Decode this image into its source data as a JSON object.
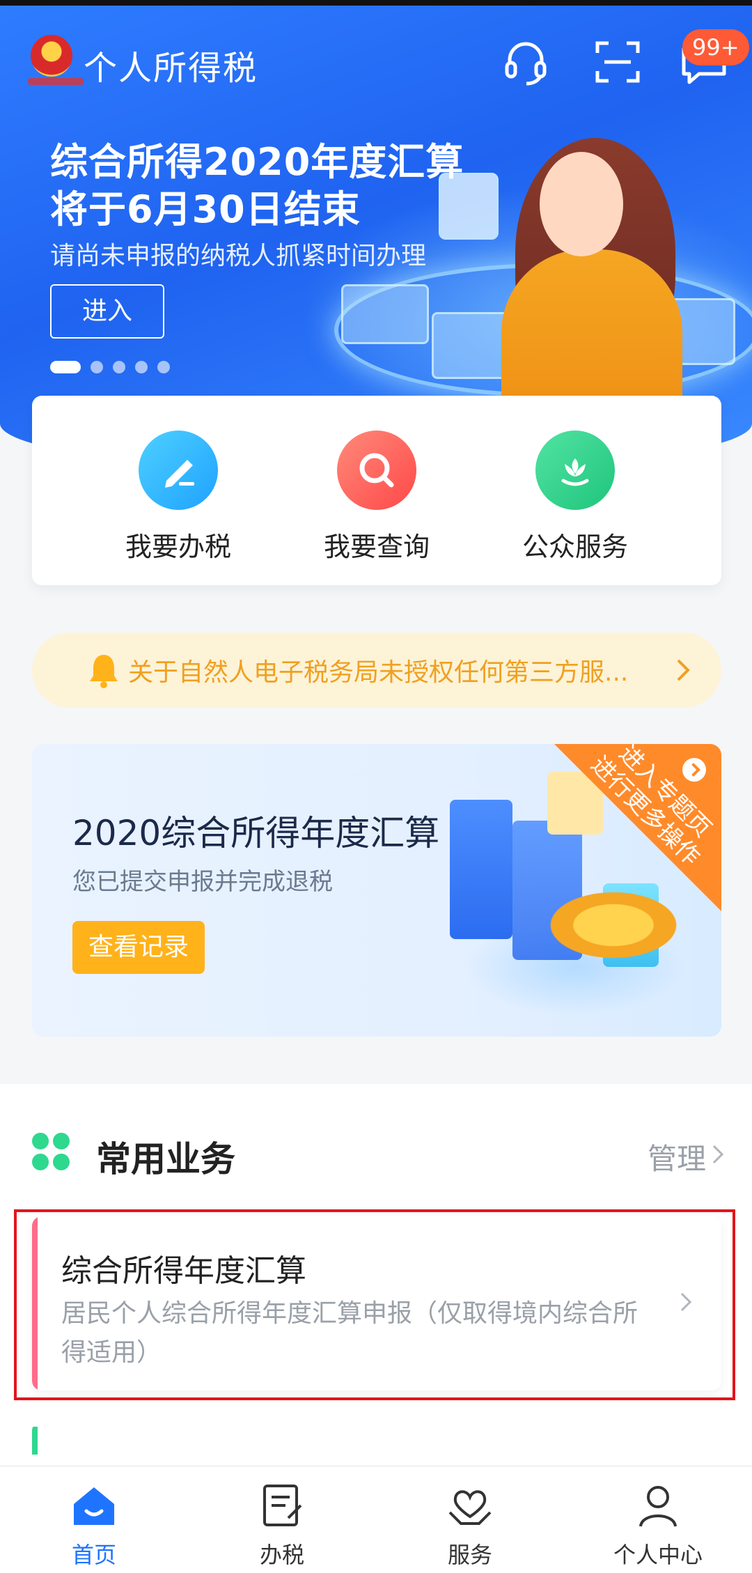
{
  "header": {
    "title": "个人所得税",
    "badge": "99+"
  },
  "banner": {
    "title_line1": "综合所得2020年度汇算",
    "title_line2": "将于6月30日结束",
    "subtitle": "请尚未申报的纳税人抓紧时间办理",
    "enter_label": "进入",
    "page_count": 5,
    "active_page": 1
  },
  "quick_actions": [
    {
      "label": "我要办税",
      "icon": "edit-icon",
      "color": "#1fb5ff"
    },
    {
      "label": "我要查询",
      "icon": "search-icon",
      "color": "#ff5b5b"
    },
    {
      "label": "公众服务",
      "icon": "flower-icon",
      "color": "#2ed88f"
    }
  ],
  "notice": {
    "text": "关于自然人电子税务局未授权任何第三方服..."
  },
  "promo": {
    "title": "2020综合所得年度汇算",
    "subtitle": "您已提交申报并完成退税",
    "button_label": "查看记录",
    "corner_line1": "进入专题页",
    "corner_line2": "进行更多操作"
  },
  "common_services": {
    "title": "常用业务",
    "manage_label": "管理",
    "items": [
      {
        "title": "综合所得年度汇算",
        "description": "居民个人综合所得年度汇算申报（仅取得境内综合所得适用）"
      }
    ]
  },
  "bottom_nav": [
    {
      "label": "首页",
      "icon": "home-icon",
      "active": true
    },
    {
      "label": "办税",
      "icon": "tax-doc-icon",
      "active": false
    },
    {
      "label": "服务",
      "icon": "heart-hands-icon",
      "active": false
    },
    {
      "label": "个人中心",
      "icon": "person-icon",
      "active": false
    }
  ],
  "colors": {
    "primary": "#1f74ff",
    "accent_orange": "#ffb21a",
    "notice_text": "#f0a020",
    "highlight_border": "#e3141c"
  }
}
